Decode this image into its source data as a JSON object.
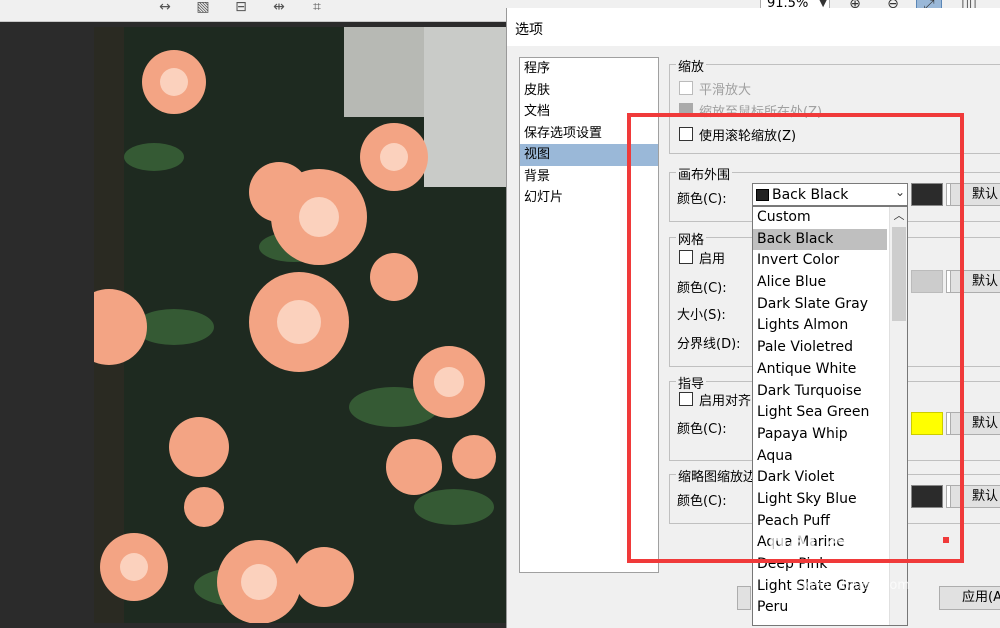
{
  "toolbar": {
    "zoom_value": "91.5%",
    "icons": [
      "resize-horizontal-icon",
      "rotate-icon",
      "align-icon",
      "fit-width-icon",
      "crop-icon",
      "zoom-in-icon",
      "zoom-out-icon",
      "fit-icon",
      "split-view-icon"
    ]
  },
  "dialog": {
    "title": "选项",
    "categories": [
      {
        "label": "程序"
      },
      {
        "label": "皮肤"
      },
      {
        "label": "文档"
      },
      {
        "label": "保存选项设置"
      },
      {
        "label": "视图",
        "selected": true
      },
      {
        "label": "背景"
      },
      {
        "label": "幻灯片"
      }
    ],
    "zoom_group": {
      "title": "缩放",
      "smooth_zoom": "平滑放大",
      "zoom_to_mouse": "缩放至鼠标所在处(Z)",
      "wheel_zoom": "使用滚轮缩放(Z)"
    },
    "canvas_group": {
      "title": "画布外围",
      "color_label": "颜色(C):",
      "selected_color": "Back Black",
      "swatch_color": "#2b2b2b",
      "default_label": "默认"
    },
    "grid_group": {
      "title": "网格",
      "enable_label": "启用",
      "color_label": "颜色(C):",
      "size_label": "大小(S):",
      "border_label": "分界线(D):",
      "swatch_color": "#cccccc",
      "default_label": "默认"
    },
    "guide_group": {
      "title": "指导",
      "align_label": "启用对齐",
      "color_label": "颜色(C):",
      "swatch_color": "#ffff00",
      "default_label": "默认"
    },
    "thumb_group": {
      "title": "缩略图缩放边",
      "color_label": "颜色(C):",
      "swatch_color": "#2b2b2b",
      "default_label": "默认"
    },
    "apply_label": "应用(A"
  },
  "dropdown": {
    "items": [
      "Custom",
      "Back Black",
      "Invert Color",
      "Alice Blue",
      "Dark Slate Gray",
      "Lights Almon",
      "Pale Violetred",
      "Antique White",
      "Dark Turquoise",
      "Light Sea Green",
      "Papaya Whip",
      "Aqua",
      "Dark Violet",
      "Light Sky Blue",
      "Peach Puff",
      "Aqua Marine",
      "Deep Pink",
      "Light Slate Gray",
      "Peru"
    ],
    "highlighted_index": 1
  },
  "annotation_color": "#f03a3a",
  "watermark": {
    "text": "Bai 经验",
    "url": "jingyan.baidu.com"
  }
}
